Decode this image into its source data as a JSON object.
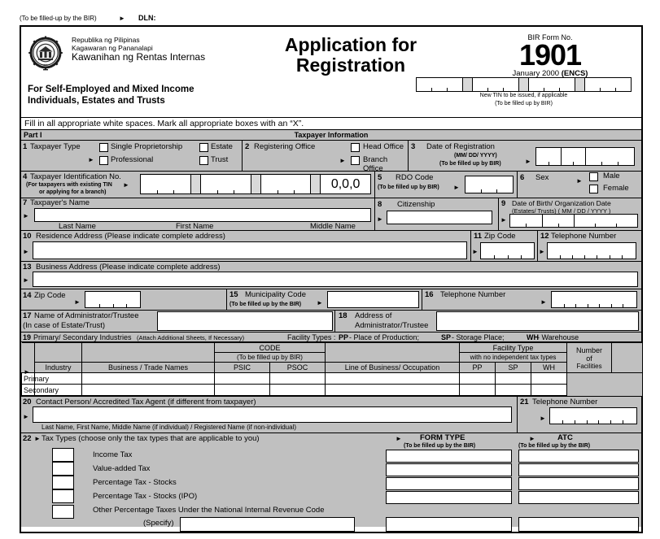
{
  "dln": {
    "note": "(To be filled-up by the BIR)",
    "arrow": "►",
    "label": "DLN:"
  },
  "header": {
    "agency_line1": "Republika ng Pilipinas",
    "agency_line2": "Kagawaran ng Pananalapi",
    "agency_line3": "Kawanihan ng Rentas Internas",
    "title_line1": "Application for",
    "title_line2": "Registration",
    "subtitle_line1": "For Self-Employed and Mixed Income",
    "subtitle_line2": "Individuals, Estates and Trusts",
    "form_no_caption": "BIR Form No.",
    "form_no": "1901",
    "form_date": "January 2000 ",
    "form_encs": "(ENCS)",
    "newtin_note1": "New TIN to be issued, if applicable",
    "newtin_note2": "(To be filled up by BIR)"
  },
  "instruction": "Fill in all appropriate white spaces.  Mark all appropriate boxes with an “X”.",
  "part": {
    "left": "Part I",
    "center": "Taxpayer Information"
  },
  "items": {
    "i1": {
      "num": "1",
      "label": "Taxpayer Type",
      "arrow": "►",
      "opt1": "Single Proprietorship",
      "opt2": "Estate",
      "opt3": "Professional",
      "opt4": "Trust"
    },
    "i2": {
      "num": "2",
      "label": "Registering Office",
      "arrow": "►",
      "opt1": "Head Office",
      "opt2": "Branch Office"
    },
    "i3": {
      "num": "3",
      "label": "Date of Registration",
      "sub1": "(MM/ DD/ YYYY)",
      "sub2": "(To be filled up by BIR)",
      "arrow": "►"
    },
    "i4": {
      "num": "4",
      "label": "Taxpayer Identification No.",
      "sub1": "(For taxpayers with existing TIN",
      "sub2": "or applying for a branch)",
      "arrow": "►",
      "branch_code": "0,0,0"
    },
    "i5": {
      "num": "5",
      "label": "RDO Code",
      "sub": "(To be filled up by BIR)",
      "arrow": "►"
    },
    "i6": {
      "num": "6",
      "label": "Sex",
      "arrow": "►",
      "opt1": "Male",
      "opt2": "Female"
    },
    "i7": {
      "num": "7",
      "label": "Taxpayer's Name",
      "arrow": "►",
      "c1": "Last Name",
      "c2": "First Name",
      "c3": "Middle Name"
    },
    "i8": {
      "num": "8",
      "label": "Citizenship",
      "arrow": "►"
    },
    "i9": {
      "num": "9",
      "label": "Date of Birth/ Organization Date",
      "sub": "(Estates/ Trusts) ( MM / DD / YYYY )",
      "arrow": "►"
    },
    "i10": {
      "num": "10",
      "label": "Residence Address  (Please indicate complete address)",
      "arrow": "►"
    },
    "i11": {
      "num": "11",
      "label": "Zip Code",
      "arrow": "►"
    },
    "i12": {
      "num": "12",
      "label": "Telephone Number",
      "arrow": "►"
    },
    "i13": {
      "num": "13",
      "label": "Business Address  (Please indicate complete address)",
      "arrow": "►"
    },
    "i14": {
      "num": "14",
      "label": "Zip Code",
      "arrow": "►"
    },
    "i15": {
      "num": "15",
      "label": "Municipality Code",
      "sub": "(To be filled up by the BIR)",
      "arrow": "►"
    },
    "i16": {
      "num": "16",
      "label": "Telephone Number",
      "arrow": "►"
    },
    "i17": {
      "num": "17",
      "label": "Name of Administrator/Trustee",
      "sub": "(In case of Estate/Trust)"
    },
    "i18": {
      "num": "18",
      "label": "Address of",
      "label2": "Administrator/Trustee"
    },
    "i19": {
      "num": "19",
      "label": "Primary/ Secondary Industries",
      "sub": "(Attach Additional Sheets, If Necessary)",
      "facility_types": "Facility Types :",
      "ft1_code": "PP",
      "ft1_name": " -  Place of Production;",
      "ft2_code": "SP",
      "ft2_name": " -  Storage Place;",
      "ft3_code": "WH",
      "ft3_name": " -  Warehouse",
      "arrow": "►",
      "col_industry": "Industry",
      "col_trade": "Business / Trade Names",
      "col_code": "CODE",
      "col_code_sub": "(To be filled up by BIR)",
      "col_psic": "PSIC",
      "col_psoc": "PSOC",
      "col_line": "Line of Business/ Occupation",
      "col_facility": "Facility Type",
      "col_facility_sub": "with no independent tax types",
      "col_pp": "PP",
      "col_sp": "SP",
      "col_wh": "WH",
      "col_numfac1": "Number",
      "col_numfac2": "of",
      "col_numfac3": "Facilities",
      "rows": [
        "Primary",
        "Secondary"
      ]
    },
    "i20": {
      "num": "20",
      "label": "Contact Person/ Accredited Tax Agent (if different from taxpayer)",
      "arrow": "►",
      "foot": "Last Name, First Name, Middle Name (if individual) / Registered Name (if non-individual)"
    },
    "i21": {
      "num": "21",
      "label": "Telephone Number",
      "arrow": "►"
    },
    "i22": {
      "num": "22",
      "arrow": "►",
      "label": "Tax Types (choose only the tax types that are applicable to  you)",
      "form_type_header": "FORM TYPE",
      "form_type_sub": "(To be filled up by the BIR)",
      "atc_header": "ATC",
      "atc_sub": "(To be filled up by the BIR)",
      "arrow_ft": "►",
      "arrow_atc": "►",
      "tax_types": [
        "Income Tax",
        "Value-added Tax",
        "Percentage Tax - Stocks",
        "Percentage Tax - Stocks (IPO)",
        "Other Percentage Taxes Under the National Internal Revenue Code"
      ],
      "specify": "(Specify)"
    }
  },
  "colors": {
    "panel": "#c0c0c0",
    "field": "#ffffff",
    "border": "#000000",
    "sep": "#d9d9d9"
  }
}
